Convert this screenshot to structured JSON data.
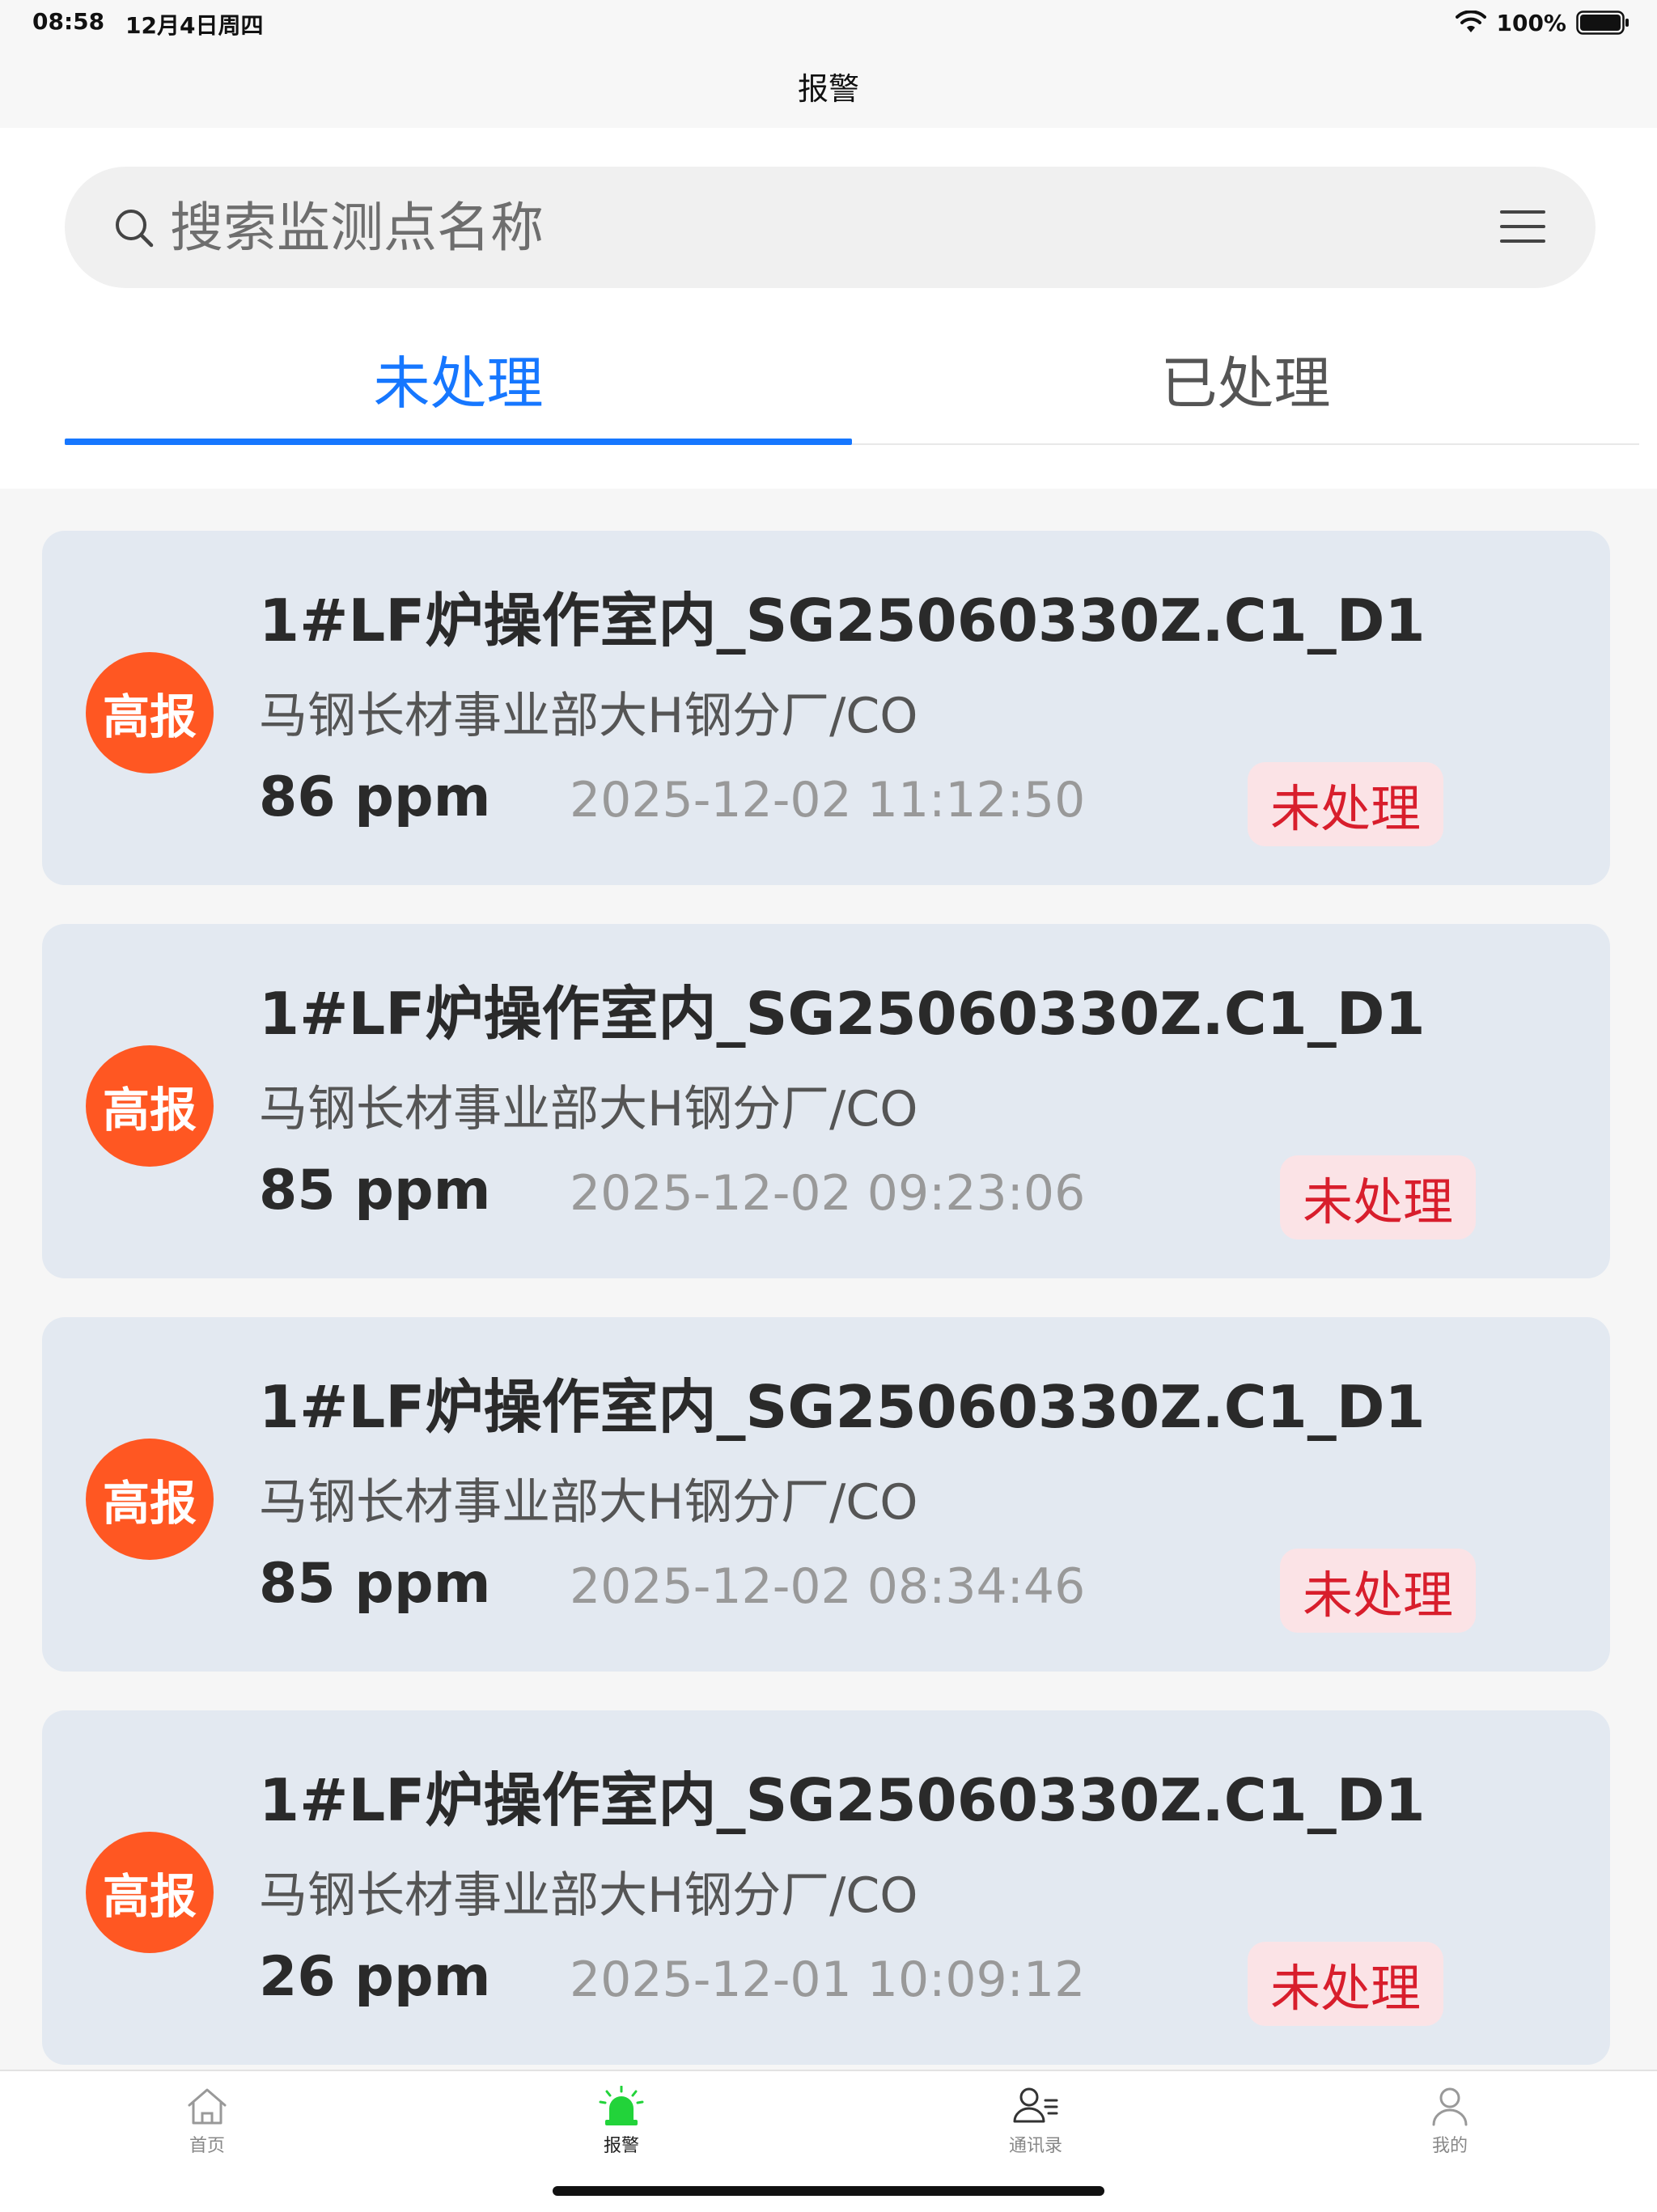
{
  "status_bar": {
    "time": "08:58",
    "date": "12月4日周四",
    "battery": "100%"
  },
  "nav": {
    "title": "报警"
  },
  "search": {
    "placeholder": "搜索监测点名称"
  },
  "tabs": [
    {
      "label": "未处理",
      "active": true
    },
    {
      "label": "已处理",
      "active": false
    }
  ],
  "alarms": [
    {
      "level": "高报",
      "title": "1#LF炉操作室内_SG25060330Z.C1_D1",
      "location": "马钢长材事业部大H钢分厂/CO",
      "value": "86 ppm",
      "time": "2025-12-02 11:12:50",
      "status": "未处理"
    },
    {
      "level": "高报",
      "title": "1#LF炉操作室内_SG25060330Z.C1_D1",
      "location": "马钢长材事业部大H钢分厂/CO",
      "value": "85 ppm",
      "time": "2025-12-02 09:23:06",
      "status": "未处理"
    },
    {
      "level": "高报",
      "title": "1#LF炉操作室内_SG25060330Z.C1_D1",
      "location": "马钢长材事业部大H钢分厂/CO",
      "value": "85 ppm",
      "time": "2025-12-02 08:34:46",
      "status": "未处理"
    },
    {
      "level": "高报",
      "title": "1#LF炉操作室内_SG25060330Z.C1_D1",
      "location": "马钢长材事业部大H钢分厂/CO",
      "value": "26 ppm",
      "time": "2025-12-01 10:09:12",
      "status": "未处理"
    }
  ],
  "tab_bar": [
    {
      "label": "首页",
      "icon": "home-icon"
    },
    {
      "label": "报警",
      "icon": "alarm-siren-icon",
      "active": true
    },
    {
      "label": "通讯录",
      "icon": "contacts-icon"
    },
    {
      "label": "我的",
      "icon": "profile-icon"
    }
  ],
  "colors": {
    "accent": "#1677ff",
    "badge": "#ff5722",
    "status_text": "#d81e2c",
    "status_bg": "#fbe3e6",
    "active_tab_icon": "#22d33a"
  }
}
